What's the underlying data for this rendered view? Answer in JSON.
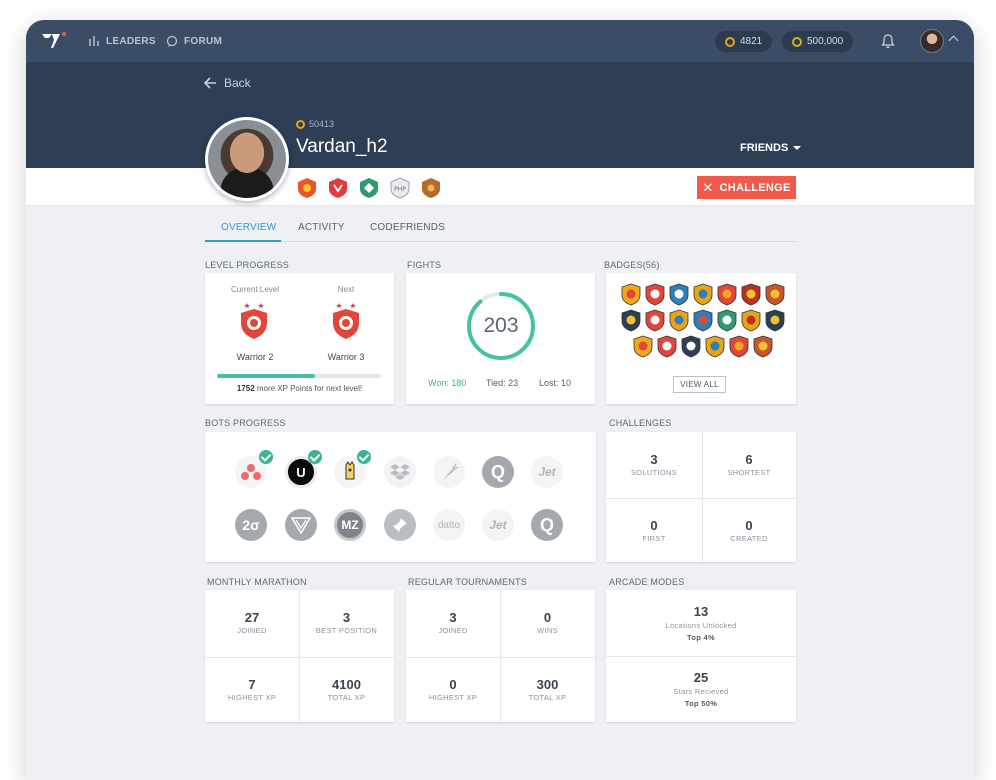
{
  "nav": {
    "leaders_label": "LEADERS",
    "forum_label": "FORUM",
    "coins_value": "4821",
    "gems_value": "500,000"
  },
  "header": {
    "back_label": "Back",
    "xp_value": "50413",
    "username": "Vardan_h2",
    "friends_label": "FRIENDS",
    "challenge_label": "CHALLENGE"
  },
  "tabs": [
    {
      "label": "OVERVIEW",
      "active": true
    },
    {
      "label": "ACTIVITY",
      "active": false
    },
    {
      "label": "CODEFRIENDS",
      "active": false
    }
  ],
  "level_progress": {
    "section_label": "LEVEL PROGRESS",
    "current_title": "Current Level",
    "current_name": "Warrior 2",
    "next_title": "Next",
    "next_name": "Warrior 3",
    "progress_fraction": 0.6,
    "xp_needed": "1752",
    "xp_note_text": "more XP Points for next level!"
  },
  "fights": {
    "section_label": "FIGHTS",
    "total": "203",
    "won_text": "Won: 180",
    "tied_text": "Tied: 23",
    "lost_text": "Lost: 10",
    "won_fraction": 0.887
  },
  "badges": {
    "section_label": "BADGES(56)",
    "view_all_label": "VIEW ALL"
  },
  "bots": {
    "section_label": "BOTS PROGRESS",
    "row1": [
      {
        "name": "asana",
        "text": "",
        "checked": true
      },
      {
        "name": "uber",
        "text": "U",
        "checked": true
      },
      {
        "name": "mascot",
        "text": "",
        "checked": true
      },
      {
        "name": "dropbox",
        "text": "",
        "checked": false
      },
      {
        "name": "instacart",
        "text": "",
        "checked": false
      },
      {
        "name": "quora",
        "text": "Q",
        "checked": false
      },
      {
        "name": "jet",
        "text": "Jet",
        "checked": false
      }
    ],
    "row2": [
      {
        "name": "twosigma",
        "text": "2σ",
        "checked": false
      },
      {
        "name": "codefights",
        "text": "",
        "checked": false
      },
      {
        "name": "mz",
        "text": "MZ",
        "checked": false
      },
      {
        "name": "pin",
        "text": "",
        "checked": false
      },
      {
        "name": "datto",
        "text": "datto",
        "checked": false
      },
      {
        "name": "jet2",
        "text": "Jet",
        "checked": false
      },
      {
        "name": "quora2",
        "text": "Q",
        "checked": false
      }
    ]
  },
  "challenges": {
    "section_label": "CHALLENGES",
    "solutions_value": "3",
    "solutions_label": "SOLUTIONS",
    "shortest_value": "6",
    "shortest_label": "SHORTEST",
    "first_value": "0",
    "first_label": "FIRST",
    "created_value": "0",
    "created_label": "CREATED"
  },
  "marathon": {
    "section_label": "MONTHLY MARATHON",
    "joined_value": "27",
    "joined_label": "JOINED",
    "best_value": "3",
    "best_label": "BEST POSITION",
    "highest_value": "7",
    "highest_label": "HIGHEST XP",
    "total_value": "4100",
    "total_label": "TOTAL XP"
  },
  "tournaments": {
    "section_label": "REGULAR TOURNAMENTS",
    "joined_value": "3",
    "joined_label": "JOINED",
    "wins_value": "0",
    "wins_label": "WINS",
    "highest_value": "0",
    "highest_label": "HIGHEST XP",
    "total_value": "300",
    "total_label": "TOTAL XP"
  },
  "arcade": {
    "section_label": "ARCADE MODES",
    "locations_value": "13",
    "locations_label": "Locations Unlocked",
    "locations_top": "Top 4%",
    "stars_value": "25",
    "stars_label": "Stars Recieved",
    "stars_top": "Top 50%"
  },
  "colors": {
    "nav_bg": "#3b4d66",
    "band_bg": "#2d3e55",
    "accent_blue": "#2f9bdc",
    "accent_green": "#44c3a4",
    "challenge_red": "#f2594b"
  }
}
